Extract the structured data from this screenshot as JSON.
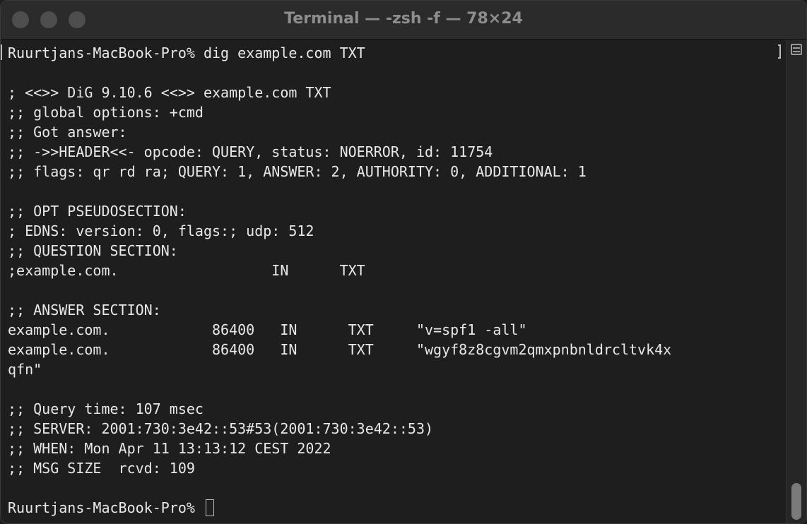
{
  "window": {
    "title": "Terminal — -zsh -f — 78×24"
  },
  "terminal": {
    "lines": [
      "Ruurtjans-MacBook-Pro% dig example.com TXT",
      "",
      "; <<>> DiG 9.10.6 <<>> example.com TXT",
      ";; global options: +cmd",
      ";; Got answer:",
      ";; ->>HEADER<<- opcode: QUERY, status: NOERROR, id: 11754",
      ";; flags: qr rd ra; QUERY: 1, ANSWER: 2, AUTHORITY: 0, ADDITIONAL: 1",
      "",
      ";; OPT PSEUDOSECTION:",
      "; EDNS: version: 0, flags:; udp: 512",
      ";; QUESTION SECTION:",
      ";example.com.                  IN      TXT",
      "",
      ";; ANSWER SECTION:",
      "example.com.            86400   IN      TXT     \"v=spf1 -all\"",
      "example.com.            86400   IN      TXT     \"wgyf8z8cgvm2qmxpnbnldrcltvk4x",
      "qfn\"",
      "",
      ";; Query time: 107 msec",
      ";; SERVER: 2001:730:3e42::53#53(2001:730:3e42::53)",
      ";; WHEN: Mon Apr 11 13:13:12 CEST 2022",
      ";; MSG SIZE  rcvd: 109",
      "",
      "Ruurtjans-MacBook-Pro% "
    ]
  }
}
